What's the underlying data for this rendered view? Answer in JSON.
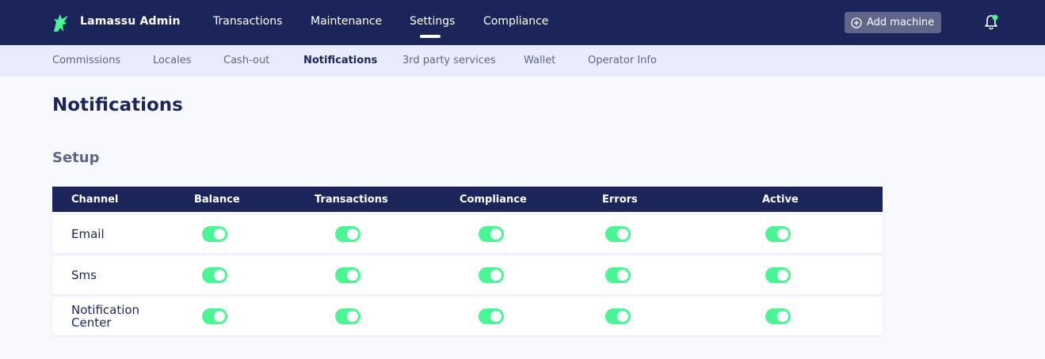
{
  "header": {
    "brand": "Lamassu Admin",
    "nav": [
      "Transactions",
      "Maintenance",
      "Settings",
      "Compliance"
    ],
    "active_nav": "Settings",
    "add_machine_label": "Add machine",
    "icons": [
      "lamassu-logo-icon",
      "plus-circle-icon",
      "bell-icon"
    ],
    "colors": {
      "navy": "#1b2559",
      "accent_green": "#48f694"
    }
  },
  "subnav": {
    "items": [
      "Commissions",
      "Locales",
      "Cash-out",
      "Notifications",
      "3rd party services",
      "Wallet",
      "Operator Info"
    ],
    "active": "Notifications"
  },
  "main": {
    "title": "Notifications",
    "section": "Setup",
    "table": {
      "columns": [
        "Channel",
        "Balance",
        "Transactions",
        "Compliance",
        "Errors",
        "Active"
      ],
      "rows": [
        {
          "channel": "Email",
          "values": [
            true,
            true,
            true,
            true,
            true
          ]
        },
        {
          "channel": "Sms",
          "values": [
            true,
            true,
            true,
            true,
            true
          ]
        },
        {
          "channel": "Notification Center",
          "values": [
            true,
            true,
            true,
            true,
            true
          ]
        }
      ]
    }
  }
}
